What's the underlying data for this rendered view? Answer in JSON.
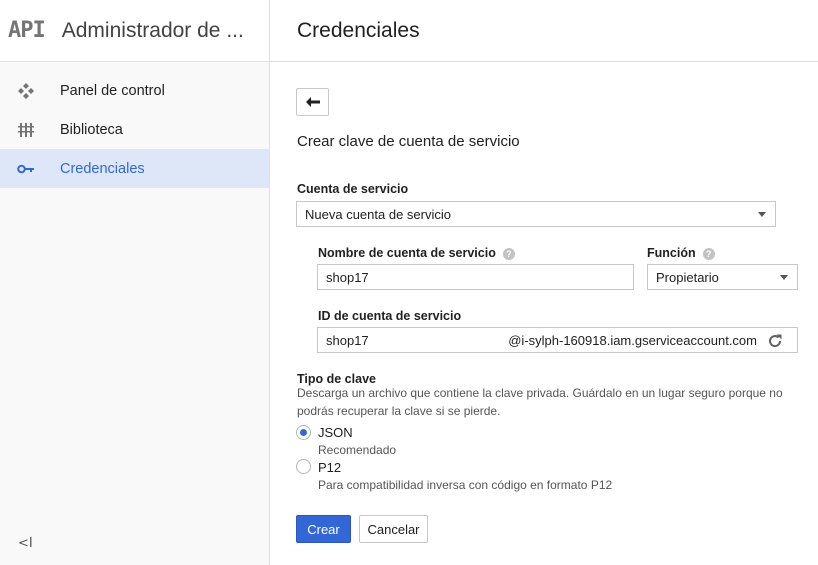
{
  "sidebar": {
    "logo_text": "API",
    "app_title": "Administrador de ...",
    "items": [
      {
        "label": "Panel de control",
        "icon": "dashboard-icon"
      },
      {
        "label": "Biblioteca",
        "icon": "library-icon"
      },
      {
        "label": "Credenciales",
        "icon": "key-icon",
        "active": true
      }
    ],
    "collapse_glyph": "<I"
  },
  "main": {
    "title": "Credenciales",
    "section_title": "Crear clave de cuenta de servicio",
    "service_account": {
      "label": "Cuenta de servicio",
      "selected": "Nueva cuenta de servicio"
    },
    "name": {
      "label": "Nombre de cuenta de servicio",
      "value": "shop17"
    },
    "role": {
      "label": "Función",
      "selected": "Propietario"
    },
    "id": {
      "label": "ID de cuenta de servicio",
      "value": "shop17",
      "domain": "@i-sylph-160918.iam.gserviceaccount.com"
    },
    "key_type": {
      "label": "Tipo de clave",
      "description": "Descarga un archivo que contiene la clave privada. Guárdalo en un lugar seguro porque no podrás recuperar la clave si se pierde.",
      "options": [
        {
          "label": "JSON",
          "sub": "Recomendado",
          "checked": true
        },
        {
          "label": "P12",
          "sub": "Para compatibilidad inversa con código en formato P12",
          "checked": false
        }
      ]
    },
    "buttons": {
      "create": "Crear",
      "cancel": "Cancelar"
    }
  },
  "colors": {
    "accent": "#3367d6",
    "active_bg": "#dde7f7"
  }
}
